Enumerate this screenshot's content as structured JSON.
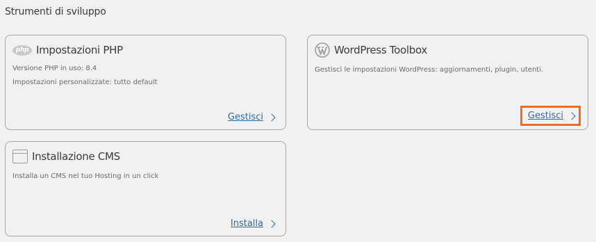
{
  "section": {
    "title": "Strumenti di sviluppo"
  },
  "cards": {
    "php": {
      "icon": "php-logo-icon",
      "icon_text": "php",
      "title": "Impostazioni PHP",
      "lines": [
        "Versione PHP in uso: 8.4",
        "Impostazioni personalizzate: tutto default"
      ],
      "action_label": "Gestisci"
    },
    "wordpress": {
      "icon": "wordpress-logo-icon",
      "title": "WordPress Toolbox",
      "lines": [
        "Gestisci le impostazioni WordPress: aggiornamenti, plugin, utenti."
      ],
      "action_label": "Gestisci"
    },
    "cms": {
      "icon": "browser-window-icon",
      "title": "Installazione CMS",
      "lines": [
        "Installa un CMS nel tuo Hosting in un click"
      ],
      "action_label": "Installa"
    }
  },
  "colors": {
    "link": "#2c6aa0",
    "highlight": "#f26a1f",
    "border": "#a7a7a7",
    "background": "#f1f1f1"
  }
}
